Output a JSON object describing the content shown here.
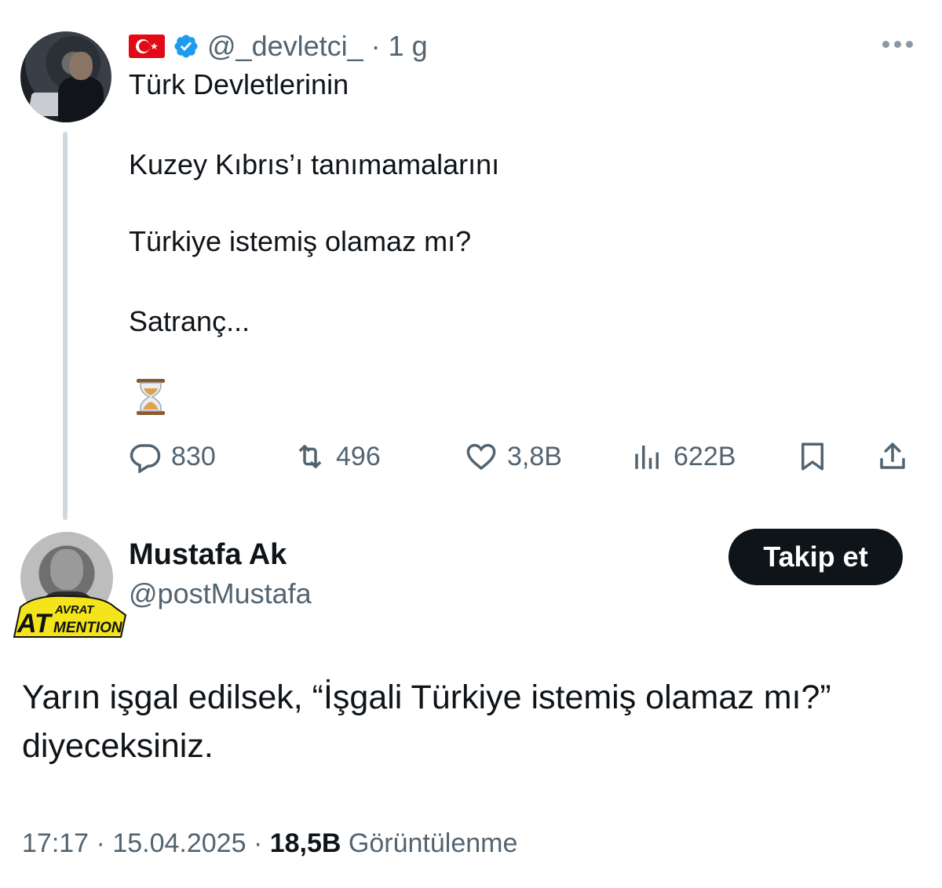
{
  "parent_tweet": {
    "handle": "@_devletci_",
    "separator": "·",
    "time": "1 g",
    "lines": [
      "Türk Devletlerinin",
      "Kuzey Kıbrıs’ı tanımamalarını",
      "Türkiye istemiş olamaz mı?",
      "Satranç..."
    ],
    "emoji": "⏳",
    "stats": {
      "replies": "830",
      "retweets": "496",
      "likes": "3,8B",
      "views": "622B"
    }
  },
  "reply": {
    "name": "Mustafa Ak",
    "handle": "@postMustafa",
    "follow_label": "Takip et",
    "text_line1": "Yarın işgal edilsek, “İşgali Türkiye istemiş olamaz mı?”",
    "text_line2": "diyeceksiniz.",
    "badge_top": "AVRAT",
    "badge_bottom": "MENTION",
    "badge_letters": "AT",
    "time": "17:17",
    "date": "15.04.2025",
    "views_count": "18,5B",
    "views_label": "Görüntülenme",
    "separator": "·"
  },
  "icons": [
    "flag-tr-icon",
    "verified-icon",
    "more-icon",
    "reply-icon",
    "retweet-icon",
    "like-icon",
    "views-icon",
    "bookmark-icon",
    "share-icon"
  ],
  "colors": {
    "text": "#0f1419",
    "secondary": "#536471",
    "verified": "#1d9bf0",
    "thread": "#cfd9de",
    "button": "#0f1419",
    "badge_yellow": "#f4e41c"
  }
}
